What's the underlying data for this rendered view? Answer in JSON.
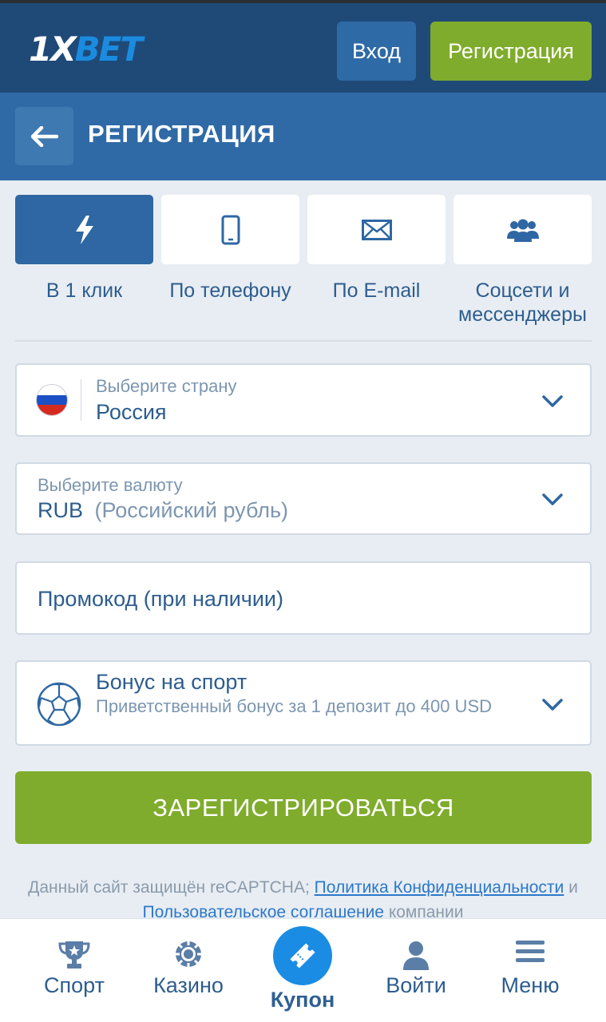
{
  "header": {
    "logo_part1": "1X",
    "logo_part2": "BET",
    "login_label": "Вход",
    "register_label": "Регистрация"
  },
  "title_bar": {
    "title": "РЕГИСТРАЦИЯ"
  },
  "tabs": [
    {
      "label": "В 1 клик",
      "icon": "lightning-icon",
      "active": true
    },
    {
      "label": "По телефону",
      "icon": "phone-icon",
      "active": false
    },
    {
      "label": "По E-mail",
      "icon": "envelope-icon",
      "active": false
    },
    {
      "label": "Соцсети и мессенджеры",
      "icon": "people-icon",
      "active": false
    }
  ],
  "form": {
    "country": {
      "label": "Выберите страну",
      "value": "Россия"
    },
    "currency": {
      "label": "Выберите валюту",
      "code": "RUB",
      "name": "(Российский рубль)"
    },
    "promo": {
      "placeholder": "Промокод (при наличии)"
    },
    "bonus": {
      "title": "Бонус на спорт",
      "description": "Приветственный бонус за 1 депозит до 400 USD"
    },
    "submit_label": "ЗАРЕГИСТРИРОВАТЬСЯ"
  },
  "legal": {
    "text1": "Данный сайт защищён reCAPTCHA; ",
    "link1": "Политика Конфиденциальности",
    "text2": " и ",
    "link2": "Пользовательское соглашение",
    "text3": " компании"
  },
  "bottom_nav": [
    {
      "label": "Спорт",
      "icon": "trophy-icon"
    },
    {
      "label": "Казино",
      "icon": "casino-chip-icon"
    },
    {
      "label": "Купон",
      "icon": "ticket-icon"
    },
    {
      "label": "Войти",
      "icon": "user-icon"
    },
    {
      "label": "Меню",
      "icon": "menu-icon"
    }
  ],
  "colors": {
    "header_bg": "#1f4a78",
    "title_bg": "#2f6aa7",
    "accent_green": "#7fac2c",
    "accent_blue": "#1b8ce3",
    "text_blue": "#2d5d8e"
  }
}
